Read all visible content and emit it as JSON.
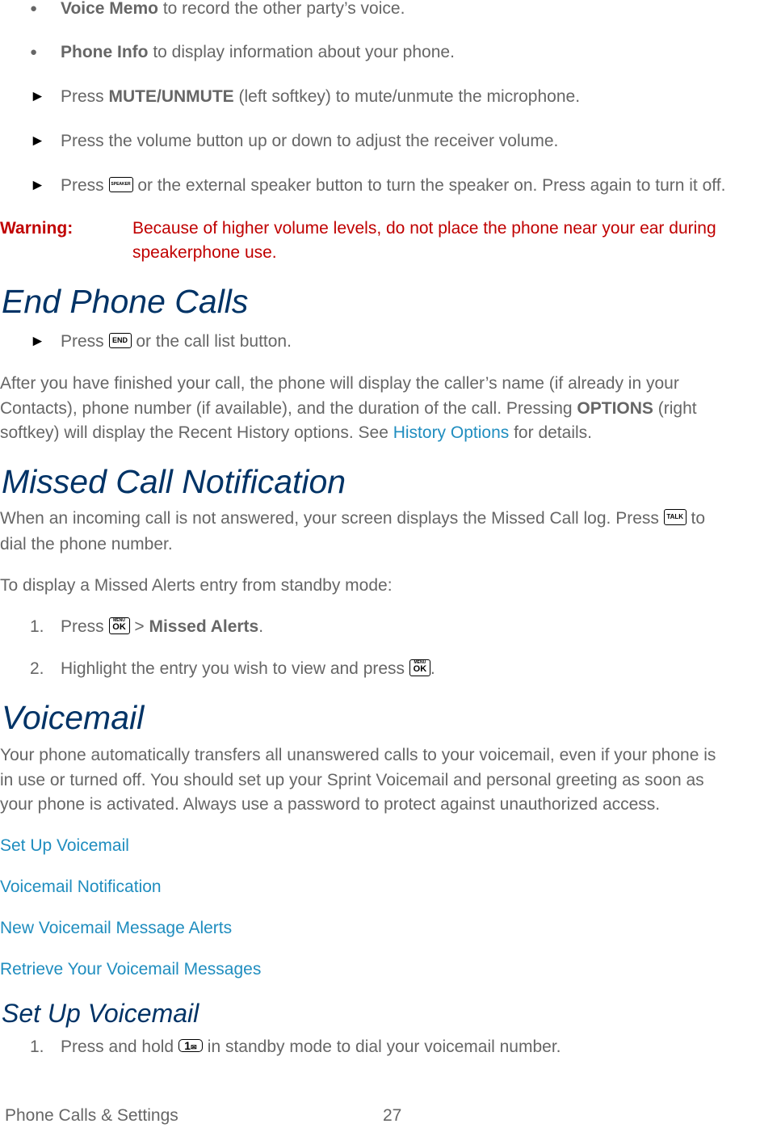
{
  "bullets": [
    {
      "bold": "Voice Memo",
      "rest": " to record the other party’s voice."
    },
    {
      "bold": "Phone Info",
      "rest": " to display information about your phone."
    }
  ],
  "steps_in_call": [
    {
      "pre": "Press ",
      "bold": "MUTE/UNMUTE",
      "rest": " (left softkey) to mute/unmute the microphone."
    },
    {
      "text": "Press the volume button up or down to adjust the receiver volume."
    },
    {
      "pre": "Press ",
      "key": "SPEAKER",
      "rest": " or the external speaker button to turn the speaker on. Press again to turn it off."
    }
  ],
  "warning": {
    "label": "Warning:",
    "line1": "Because of higher volume levels, do not place the phone near your ear during",
    "line2": "speakerphone use."
  },
  "end_calls": {
    "heading": "End Phone Calls",
    "step": {
      "pre": "Press ",
      "key": "END",
      "rest": " or the call list button."
    },
    "para_line1": "After you have finished your call, the phone will display the caller’s name (if already in your",
    "para_line2_pre": "Contacts), phone number (if available), and the duration of the call. Pressing ",
    "para_line2_bold": "OPTIONS",
    "para_line2_post": " (right",
    "para_line3_pre": "softkey) will display the Recent History options. See ",
    "para_line3_link": "History Options",
    "para_line3_post": " for details."
  },
  "missed": {
    "heading": "Missed Call Notification",
    "para_line1_pre": "When an incoming call is not answered, your screen displays the Missed Call log. Press ",
    "para_key": "TALK",
    "para_line1_post": " to",
    "para_line2": "dial the phone number.",
    "intro": "To display a Missed Alerts entry from standby mode:",
    "steps": [
      {
        "num": "1.",
        "pre": "Press ",
        "key_small": "MENU",
        "key_big": "OK",
        "mid": " > ",
        "bold": "Missed Alerts",
        "rest": "."
      },
      {
        "num": "2.",
        "pre": "Highlight the entry you wish to view and press ",
        "key_small": "MENU",
        "key_big": "OK",
        "rest": "."
      }
    ]
  },
  "voicemail": {
    "heading": "Voicemail",
    "para_line1": "Your phone automatically transfers all unanswered calls to your voicemail, even if your phone is",
    "para_line2": "in use or turned off. You should set up your Sprint Voicemail and personal greeting as soon as",
    "para_line3": "your phone is activated. Always use a password to protect against unauthorized access.",
    "links": [
      "Set Up Voicemail",
      "Voicemail Notification",
      "New Voicemail Message Alerts",
      "Retrieve Your Voicemail Messages"
    ]
  },
  "setup": {
    "heading": "Set Up Voicemail",
    "step": {
      "num": "1.",
      "pre": "Press and hold ",
      "key": "1",
      "rest": " in standby mode to dial your voicemail number."
    }
  },
  "footer": {
    "section": "Phone Calls & Settings",
    "page": "27"
  },
  "colors": {
    "body_text": "#666666",
    "heading": "#003366",
    "link": "#1f8dbf",
    "warning": "#c00000"
  }
}
